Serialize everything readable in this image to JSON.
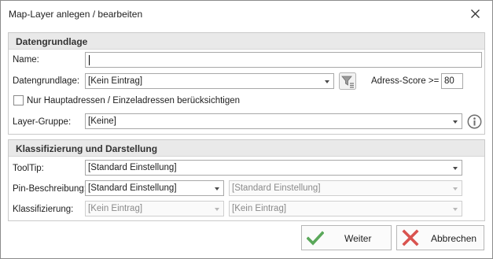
{
  "window": {
    "title": "Map-Layer anlegen / bearbeiten"
  },
  "group1": {
    "header": "Datengrundlage",
    "name": {
      "label": "Name:",
      "value": ""
    },
    "datengrundlage": {
      "label": "Datengrundlage:",
      "value": "[Kein Eintrag]"
    },
    "adress_score": {
      "label": "Adress-Score >=",
      "value": "80"
    },
    "checkbox": {
      "label": "Nur Hauptadressen / Einzeladressen berücksichtigen",
      "checked": false
    },
    "layer_gruppe": {
      "label": "Layer-Gruppe:",
      "value": "[Keine]"
    }
  },
  "group2": {
    "header": "Klassifizierung und Darstellung",
    "tooltip": {
      "label": "ToolTip:",
      "value": "[Standard Einstellung]"
    },
    "pin": {
      "label": "Pin-Beschreibung:",
      "value1": "[Standard Einstellung]",
      "value2": "[Standard Einstellung]"
    },
    "klass": {
      "label": "Klassifizierung:",
      "value1": "[Kein Eintrag]",
      "value2": "[Kein Eintrag]"
    }
  },
  "buttons": {
    "weiter": "Weiter",
    "abbrechen": "Abbrechen"
  },
  "colors": {
    "accent_green": "#5aa85a",
    "cancel_red": "#d9534f",
    "info_gray": "#6e6e6e"
  },
  "icons": [
    "close-icon",
    "filter-icon",
    "info-icon",
    "checkmark-icon",
    "x-icon",
    "dropdown-arrow-icon"
  ]
}
